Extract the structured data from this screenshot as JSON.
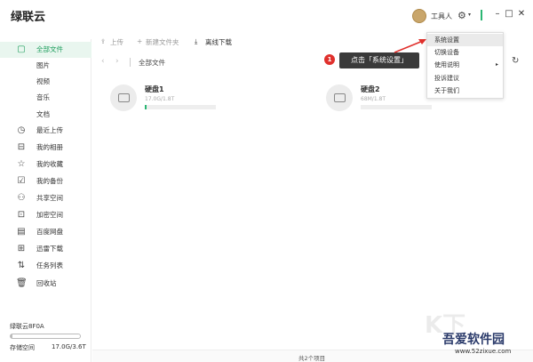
{
  "app": {
    "title": "绿联云",
    "user_name": "工具人"
  },
  "sidebar": {
    "items": [
      {
        "label": "全部文件",
        "icon": "file-icon"
      },
      {
        "label": "图片",
        "icon": ""
      },
      {
        "label": "视频",
        "icon": ""
      },
      {
        "label": "音乐",
        "icon": ""
      },
      {
        "label": "文档",
        "icon": ""
      },
      {
        "label": "最近上传",
        "icon": "clock-icon"
      },
      {
        "label": "我的相册",
        "icon": "album-icon"
      },
      {
        "label": "我的收藏",
        "icon": "star-icon"
      },
      {
        "label": "我的备份",
        "icon": "backup-icon"
      },
      {
        "label": "共享空间",
        "icon": "people-icon"
      },
      {
        "label": "加密空间",
        "icon": "lock-icon"
      },
      {
        "label": "百度网盘",
        "icon": "cloud-icon"
      },
      {
        "label": "迅雷下载",
        "icon": "thunder-icon"
      },
      {
        "label": "任务列表",
        "icon": "transfer-icon"
      },
      {
        "label": "回收站",
        "icon": "trash-icon"
      }
    ],
    "storage": {
      "device_name": "绿联云8F0A",
      "label": "存储空间",
      "value": "17.0G/3.6T",
      "used_fraction": 0.005
    }
  },
  "toolbar": {
    "upload": "上传",
    "new_folder": "新建文件夹",
    "offline_download": "离线下载"
  },
  "pathbar": {
    "current": "全部文件"
  },
  "disks": [
    {
      "name": "硬盘1",
      "size": "17.0G/1.8T",
      "used_fraction": 0.01
    },
    {
      "name": "硬盘2",
      "size": "68M/1.8T",
      "used_fraction": 0.0
    }
  ],
  "status": {
    "text": "共2个项目"
  },
  "settings_menu": {
    "items": [
      "系统设置",
      "切换设备",
      "使用说明",
      "投诉建议",
      "关于我们"
    ]
  },
  "callout": {
    "number": "1",
    "text": "点击「系统设置」"
  },
  "watermark": {
    "text": "吾爱软件园",
    "url": "www.52zixue.com"
  },
  "colors": {
    "accent": "#2bb673",
    "active_bg": "#e9f6ef",
    "callout_red": "#e0302c"
  }
}
